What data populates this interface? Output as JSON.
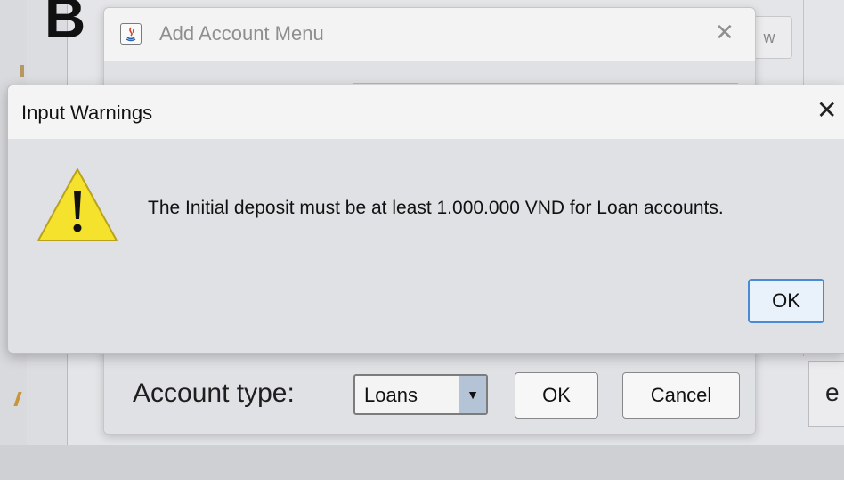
{
  "background_app": {
    "title_letter": "B",
    "right_button_label": "w",
    "right_edge_text": "e"
  },
  "account_window": {
    "title": "Add Account Menu",
    "account_type": {
      "label": "Account type:",
      "selected": "Loans"
    },
    "ok_label": "OK",
    "cancel_label": "Cancel"
  },
  "warning_dialog": {
    "title": "Input Warnings",
    "message": "The Initial deposit must be at least 1.000.000 VND for Loan accounts.",
    "ok_label": "OK",
    "icon": "warning-triangle-icon",
    "icon_color": "#f5e22c"
  },
  "colors": {
    "focus_accent": "#4a8ad4",
    "combo_arrow_bg": "#b4c3d6"
  }
}
